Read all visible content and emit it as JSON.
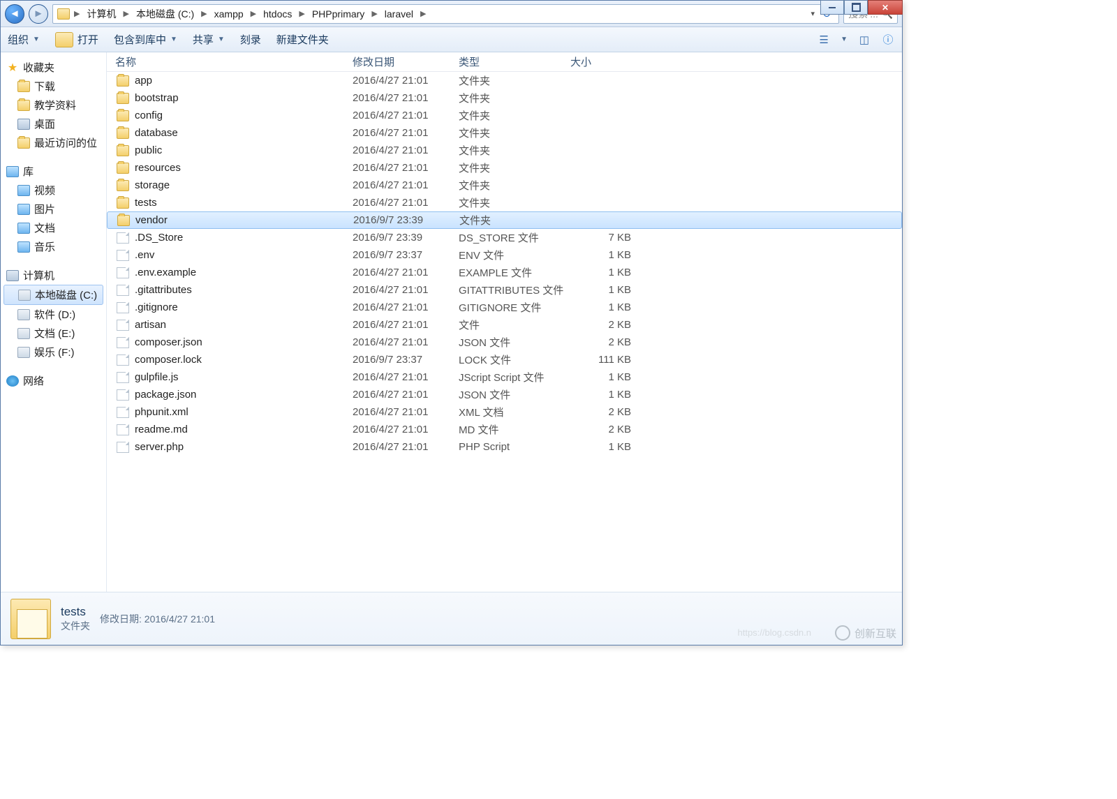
{
  "breadcrumb": [
    "计算机",
    "本地磁盘 (C:)",
    "xampp",
    "htdocs",
    "PHPprimary",
    "laravel"
  ],
  "search_placeholder": "搜索 ...",
  "toolbar": {
    "organize": "组织",
    "open": "打开",
    "include": "包含到库中",
    "share": "共享",
    "burn": "刻录",
    "newfolder": "新建文件夹"
  },
  "columns": {
    "name": "名称",
    "date": "修改日期",
    "type": "类型",
    "size": "大小"
  },
  "sidebar": {
    "favorites": {
      "label": "收藏夹",
      "items": [
        "下载",
        "教学资料",
        "桌面",
        "最近访问的位"
      ]
    },
    "libraries": {
      "label": "库",
      "items": [
        "视频",
        "图片",
        "文档",
        "音乐"
      ]
    },
    "computer": {
      "label": "计算机",
      "items": [
        "本地磁盘 (C:)",
        "软件 (D:)",
        "文档 (E:)",
        "娱乐 (F:)"
      ]
    },
    "network": {
      "label": "网络"
    }
  },
  "files": [
    {
      "n": "app",
      "d": "2016/4/27 21:01",
      "t": "文件夹",
      "s": "",
      "k": "folder"
    },
    {
      "n": "bootstrap",
      "d": "2016/4/27 21:01",
      "t": "文件夹",
      "s": "",
      "k": "folder"
    },
    {
      "n": "config",
      "d": "2016/4/27 21:01",
      "t": "文件夹",
      "s": "",
      "k": "folder"
    },
    {
      "n": "database",
      "d": "2016/4/27 21:01",
      "t": "文件夹",
      "s": "",
      "k": "folder"
    },
    {
      "n": "public",
      "d": "2016/4/27 21:01",
      "t": "文件夹",
      "s": "",
      "k": "folder"
    },
    {
      "n": "resources",
      "d": "2016/4/27 21:01",
      "t": "文件夹",
      "s": "",
      "k": "folder"
    },
    {
      "n": "storage",
      "d": "2016/4/27 21:01",
      "t": "文件夹",
      "s": "",
      "k": "folder"
    },
    {
      "n": "tests",
      "d": "2016/4/27 21:01",
      "t": "文件夹",
      "s": "",
      "k": "folder"
    },
    {
      "n": "vendor",
      "d": "2016/9/7 23:39",
      "t": "文件夹",
      "s": "",
      "k": "folder",
      "sel": true
    },
    {
      "n": ".DS_Store",
      "d": "2016/9/7 23:39",
      "t": "DS_STORE 文件",
      "s": "7 KB",
      "k": "file"
    },
    {
      "n": ".env",
      "d": "2016/9/7 23:37",
      "t": "ENV 文件",
      "s": "1 KB",
      "k": "file"
    },
    {
      "n": ".env.example",
      "d": "2016/4/27 21:01",
      "t": "EXAMPLE 文件",
      "s": "1 KB",
      "k": "file"
    },
    {
      "n": ".gitattributes",
      "d": "2016/4/27 21:01",
      "t": "GITATTRIBUTES 文件",
      "s": "1 KB",
      "k": "file"
    },
    {
      "n": ".gitignore",
      "d": "2016/4/27 21:01",
      "t": "GITIGNORE 文件",
      "s": "1 KB",
      "k": "file"
    },
    {
      "n": "artisan",
      "d": "2016/4/27 21:01",
      "t": "文件",
      "s": "2 KB",
      "k": "file"
    },
    {
      "n": "composer.json",
      "d": "2016/4/27 21:01",
      "t": "JSON 文件",
      "s": "2 KB",
      "k": "file"
    },
    {
      "n": "composer.lock",
      "d": "2016/9/7 23:37",
      "t": "LOCK 文件",
      "s": "111 KB",
      "k": "file"
    },
    {
      "n": "gulpfile.js",
      "d": "2016/4/27 21:01",
      "t": "JScript Script 文件",
      "s": "1 KB",
      "k": "script"
    },
    {
      "n": "package.json",
      "d": "2016/4/27 21:01",
      "t": "JSON 文件",
      "s": "1 KB",
      "k": "file"
    },
    {
      "n": "phpunit.xml",
      "d": "2016/4/27 21:01",
      "t": "XML 文档",
      "s": "2 KB",
      "k": "xml"
    },
    {
      "n": "readme.md",
      "d": "2016/4/27 21:01",
      "t": "MD 文件",
      "s": "2 KB",
      "k": "file"
    },
    {
      "n": "server.php",
      "d": "2016/4/27 21:01",
      "t": "PHP Script",
      "s": "1 KB",
      "k": "php"
    }
  ],
  "details": {
    "name": "tests",
    "type": "文件夹",
    "date_lbl": "修改日期:",
    "date": "2016/4/27 21:01"
  },
  "watermark": "创新互联",
  "blog": "https://blog.csdn.n"
}
